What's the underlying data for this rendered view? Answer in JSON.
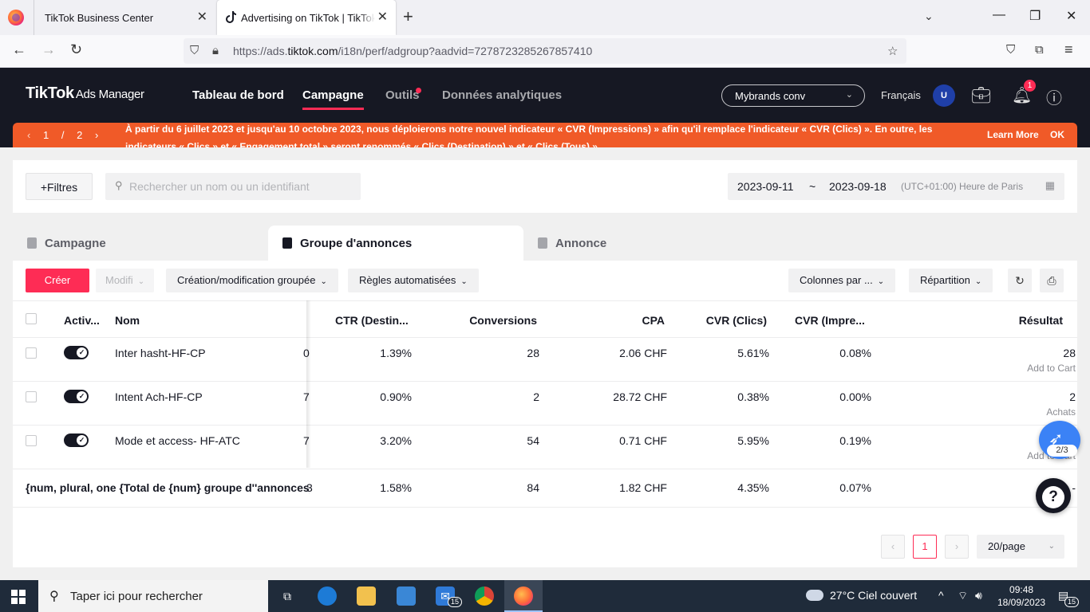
{
  "browser": {
    "tabs": [
      {
        "title": "TikTok Business Center"
      },
      {
        "title": "Advertising on TikTok | TikTok Ads Manager"
      }
    ],
    "url_prefix": "https://ads.",
    "url_domain": "tiktok.com",
    "url_path": "/i18n/perf/adgroup?aadvid=7278723285267857410"
  },
  "header": {
    "logo": "TikTok",
    "logo_sub": "Ads Manager",
    "nav": [
      "Tableau de bord",
      "Campagne",
      "Outils",
      "Données analytiques"
    ],
    "active_nav": "Campagne",
    "account": "Mybrands conv",
    "language": "Français",
    "avatar_initial": "U",
    "notification_count": "1"
  },
  "banner": {
    "page_current": "1",
    "page_sep": "/",
    "page_total": "2",
    "text": "À partir du 6 juillet 2023 et jusqu'au 10 octobre 2023, nous déploierons notre nouvel indicateur « CVR (Impressions) » afin qu'il remplace l'indicateur « CVR (Clics) ». En outre, les indicateurs « Clics » et « Engagement total » seront renommés « Clics (Destination) » et « Clics (Tous) ».",
    "learn_more": "Learn More",
    "ok": "OK",
    "color": "#f05a28"
  },
  "filters": {
    "filter_label": "Filtres",
    "search_placeholder": "Rechercher un nom ou un identifiant",
    "date_start": "2023-09-11",
    "date_sep": "~",
    "date_end": "2023-09-18",
    "timezone": "(UTC+01:00) Heure de Paris"
  },
  "entity_tabs": [
    "Campagne",
    "Groupe d'annonces",
    "Annonce"
  ],
  "active_entity_tab": "Groupe d'annonces",
  "toolbar": {
    "create": "Créer",
    "modify": "Modifi",
    "bulk": "Création/modification groupée",
    "rules": "Règles automatisées",
    "columns": "Colonnes par ...",
    "breakdown": "Répartition"
  },
  "table": {
    "columns": [
      "Activ...",
      "Nom",
      "CTR (Destin...",
      "Conversions",
      "CPA",
      "CVR (Clics)",
      "CVR (Impre...",
      "Résultat"
    ],
    "rows": [
      {
        "name": "Inter hasht-HF-CP",
        "clip": "0",
        "ctr": "1.39%",
        "conversions": "28",
        "cpa": "2.06 CHF",
        "cvr_clicks": "5.61%",
        "cvr_impr": "0.08%",
        "result": "28",
        "result_type": "Add to Cart"
      },
      {
        "name": "Intent Ach-HF-CP",
        "clip": "7",
        "ctr": "0.90%",
        "conversions": "2",
        "cpa": "28.72 CHF",
        "cvr_clicks": "0.38%",
        "cvr_impr": "0.00%",
        "result": "2",
        "result_type": "Achats"
      },
      {
        "name": "Mode et access- HF-ATC",
        "clip": "7",
        "ctr": "3.20%",
        "conversions": "54",
        "cpa": "0.71 CHF",
        "cvr_clicks": "5.95%",
        "cvr_impr": "0.19%",
        "result": "",
        "result_type": "Add to Cart"
      }
    ],
    "total": {
      "name": "{num, plural, one {Total de {num} groupe d''annonces}",
      "clip": "3",
      "ctr": "1.58%",
      "conversions": "84",
      "cpa": "1.82 CHF",
      "cvr_clicks": "4.35%",
      "cvr_impr": "0.07%",
      "result": "-"
    }
  },
  "pagination": {
    "current": "1",
    "page_size": "20/page"
  },
  "widget": {
    "progress": "2/3"
  },
  "taskbar": {
    "search_placeholder": "Taper ici pour rechercher",
    "mail_badge": "15",
    "weather": "27°C  Ciel couvert",
    "time": "09:48",
    "date": "18/09/2023",
    "notif_badge": "15"
  },
  "colors": {
    "brand": "#fe2c55",
    "header_bg": "#161823"
  }
}
